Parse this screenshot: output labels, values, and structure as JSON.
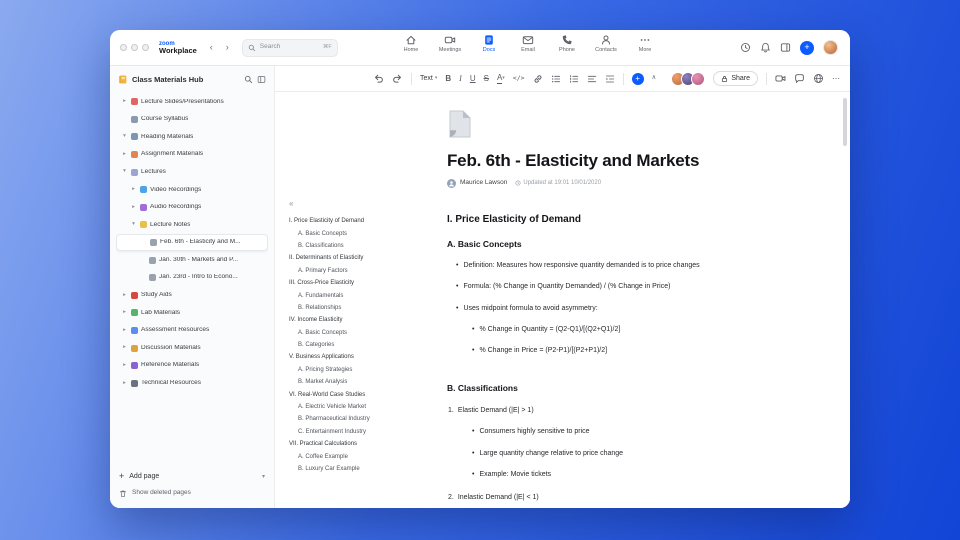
{
  "icons": {
    "back": "‹",
    "forward": "›",
    "plus": "+",
    "dropdown": "▾",
    "chevron_up": "∧",
    "collapse": "«",
    "more": "⋯",
    "bullet": "•"
  },
  "titlebar": {
    "brand_top": "zoom",
    "brand_bottom": "Workplace",
    "search_placeholder": "Search",
    "search_shortcut": "⌘F",
    "tabs": [
      {
        "label": "Home"
      },
      {
        "label": "Meetings"
      },
      {
        "label": "Docs",
        "active": true
      },
      {
        "label": "Email"
      },
      {
        "label": "Phone"
      },
      {
        "label": "Contacts"
      },
      {
        "label": "More"
      }
    ],
    "accent_color": "#0b5cff"
  },
  "sidebar": {
    "title": "Class Materials Hub",
    "items": [
      {
        "label": "Lecture Slides/Presentations",
        "level": 0,
        "chevron": "right",
        "icon": "presentation",
        "color": "#e06666"
      },
      {
        "label": "Course Syllabus",
        "level": 0,
        "chevron": "none",
        "icon": "syllabus",
        "color": "#8d99ae"
      },
      {
        "label": "Reading Materials",
        "level": 0,
        "chevron": "down",
        "icon": "book",
        "color": "#7f96b2"
      },
      {
        "label": "Assignment Materials",
        "level": 0,
        "chevron": "right",
        "icon": "assignment",
        "color": "#e08650"
      },
      {
        "label": "Lectures",
        "level": 0,
        "chevron": "down",
        "icon": "lectures",
        "color": "#9aa5d1"
      },
      {
        "label": "Video Recordings",
        "level": 1,
        "chevron": "right",
        "icon": "video",
        "color": "#4da3e8"
      },
      {
        "label": "Audio Recordings",
        "level": 1,
        "chevron": "right",
        "icon": "audio",
        "color": "#a06cd5"
      },
      {
        "label": "Lecture Notes",
        "level": 1,
        "chevron": "down",
        "icon": "notes",
        "color": "#e8c04a"
      },
      {
        "label": "Feb. 6th - Elasticity and M...",
        "level": 2,
        "chevron": "none",
        "icon": "page",
        "color": "#9aa2ad",
        "selected": true
      },
      {
        "label": "Jan. 30th - Markets and P...",
        "level": 2,
        "chevron": "none",
        "icon": "page",
        "color": "#9aa2ad"
      },
      {
        "label": "Jan. 23rd - Intro to Econo...",
        "level": 2,
        "chevron": "none",
        "icon": "page",
        "color": "#9aa2ad"
      },
      {
        "label": "Study Aids",
        "level": 0,
        "chevron": "right",
        "icon": "study-aids",
        "color": "#d6493f"
      },
      {
        "label": "Lab Materials",
        "level": 0,
        "chevron": "right",
        "icon": "lab",
        "color": "#58b368"
      },
      {
        "label": "Assessment Resources",
        "level": 0,
        "chevron": "right",
        "icon": "assessment",
        "color": "#5b8def"
      },
      {
        "label": "Discussion Materials",
        "level": 0,
        "chevron": "right",
        "icon": "discussion",
        "color": "#e0a23d"
      },
      {
        "label": "Reference Materials",
        "level": 0,
        "chevron": "right",
        "icon": "reference",
        "color": "#8a63d2"
      },
      {
        "label": "Technical Resources",
        "level": 0,
        "chevron": "right",
        "icon": "technical",
        "color": "#6b7280"
      }
    ],
    "add_page": "Add page",
    "show_deleted": "Show deleted pages"
  },
  "toolbar": {
    "text_style": "Text",
    "format": {
      "bold": "B",
      "italic": "I",
      "underline": "U",
      "strike": "S",
      "color": "A",
      "code": "</>"
    },
    "share_label": "Share"
  },
  "document": {
    "title": "Feb. 6th - Elasticity and Markets",
    "author": "Maurice Lawson",
    "updated": "Updated at 19:01 10/01/2020",
    "outline": [
      {
        "label": "I. Price Elasticity of Demand",
        "level": 0
      },
      {
        "label": "A. Basic Concepts",
        "level": 1
      },
      {
        "label": "B. Classifications",
        "level": 1
      },
      {
        "label": "II. Determinants of Elasticity",
        "level": 0
      },
      {
        "label": "A. Primary Factors",
        "level": 1
      },
      {
        "label": "III. Cross-Price Elasticity",
        "level": 0
      },
      {
        "label": "A. Fundamentals",
        "level": 1
      },
      {
        "label": "B. Relationships",
        "level": 1
      },
      {
        "label": "IV. Income Elasticity",
        "level": 0
      },
      {
        "label": "A. Basic Concepts",
        "level": 1
      },
      {
        "label": "B. Categories",
        "level": 1
      },
      {
        "label": "V. Business Applications",
        "level": 0
      },
      {
        "label": "A. Pricing Strategies",
        "level": 1
      },
      {
        "label": "B. Market Analysis",
        "level": 1
      },
      {
        "label": "VI. Real-World Case Studies",
        "level": 0
      },
      {
        "label": "A. Electric Vehicle Market",
        "level": 1
      },
      {
        "label": "B. Pharmaceutical Industry",
        "level": 1
      },
      {
        "label": "C. Entertainment Industry",
        "level": 1
      },
      {
        "label": "VII. Practical Calculations",
        "level": 0
      },
      {
        "label": "A. Coffee Example",
        "level": 1
      },
      {
        "label": "B. Luxury Car Example",
        "level": 1
      }
    ],
    "blocks": [
      {
        "type": "h2",
        "text": "I. Price Elasticity of Demand"
      },
      {
        "type": "h3",
        "text": "A. Basic Concepts"
      },
      {
        "type": "ul1",
        "text": "Definition: Measures how responsive quantity demanded is to price changes"
      },
      {
        "type": "ul1",
        "text": "Formula: (% Change in Quantity Demanded) / (% Change in Price)"
      },
      {
        "type": "ul1",
        "text": "Uses midpoint formula to avoid asymmetry:"
      },
      {
        "type": "ul2",
        "text": "% Change in Quantity = (Q2-Q1)/[(Q2+Q1)/2]"
      },
      {
        "type": "ul2",
        "text": "% Change in Price = (P2-P1)/[(P2+P1)/2]"
      },
      {
        "type": "h3",
        "text": "B. Classifications"
      },
      {
        "type": "ol1",
        "num": "1.",
        "text": "Elastic Demand (|E| > 1)"
      },
      {
        "type": "ul2",
        "text": "Consumers highly sensitive to price"
      },
      {
        "type": "ul2",
        "text": "Large quantity change relative to price change"
      },
      {
        "type": "ul2",
        "text": "Example: Movie tickets"
      },
      {
        "type": "ol1",
        "num": "2.",
        "text": "Inelastic Demand (|E| < 1)"
      }
    ]
  }
}
